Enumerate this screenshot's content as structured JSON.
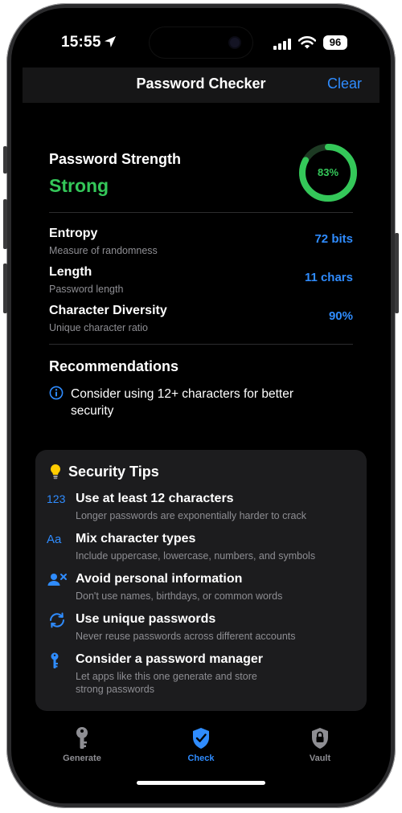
{
  "status_bar": {
    "time": "15:55",
    "battery": "96"
  },
  "nav": {
    "title": "Password Checker",
    "clear_label": "Clear"
  },
  "strength": {
    "label": "Password Strength",
    "value": "Strong",
    "percent_text": "83%",
    "percent": 83,
    "color": "#34c759"
  },
  "metrics": [
    {
      "title": "Entropy",
      "subtitle": "Measure of randomness",
      "value": "72 bits"
    },
    {
      "title": "Length",
      "subtitle": "Password length",
      "value": "11 chars"
    },
    {
      "title": "Character Diversity",
      "subtitle": "Unique character ratio",
      "value": "90%"
    }
  ],
  "recommendations": {
    "title": "Recommendations",
    "items": [
      {
        "icon": "info-icon",
        "text": "Consider using 12+ characters for better security"
      }
    ]
  },
  "tips": {
    "title": "Security Tips",
    "icon": "lightbulb-icon",
    "items": [
      {
        "icon": "123",
        "title": "Use at least 12 characters",
        "subtitle": "Longer passwords are exponentially harder to crack"
      },
      {
        "icon": "Aa",
        "title": "Mix character types",
        "subtitle": "Include uppercase, lowercase, numbers, and symbols"
      },
      {
        "icon": "person-x-icon",
        "title": "Avoid personal information",
        "subtitle": "Don't use names, birthdays, or common words"
      },
      {
        "icon": "arrows-cycle-icon",
        "title": "Use unique passwords",
        "subtitle": "Never reuse passwords across different accounts"
      },
      {
        "icon": "key-icon",
        "title": "Consider a password manager",
        "subtitle": "Let apps like this one generate and store strong passwords"
      }
    ]
  },
  "tabs": [
    {
      "label": "Generate",
      "icon": "key-icon",
      "active": false
    },
    {
      "label": "Check",
      "icon": "shield-check-icon",
      "active": true
    },
    {
      "label": "Vault",
      "icon": "lock-shield-icon",
      "active": false
    }
  ],
  "colors": {
    "accent": "#2f8cff",
    "success": "#34c759",
    "card": "#1c1c1e"
  }
}
